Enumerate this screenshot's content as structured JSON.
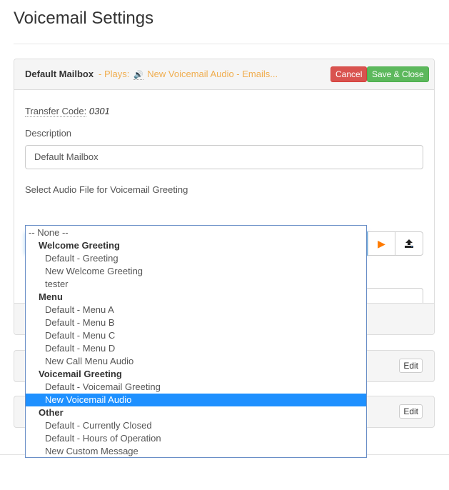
{
  "page": {
    "title": "Voicemail Settings"
  },
  "mailbox_panel": {
    "name": "Default Mailbox",
    "plays_prefix": "- Plays:",
    "speaker_icon": "🔊",
    "plays_text": "New Voicemail Audio - Emails...",
    "cancel_label": "Cancel",
    "save_label": "Save & Close",
    "transfer_code_label": "Transfer Code:",
    "transfer_code_value": "0301",
    "description_label": "Description",
    "description_value": "Default Mailbox",
    "audio_label": "Select Audio File for Voicemail Greeting",
    "audio_selected": "New Voicemail Audio",
    "caret_icon": "▼",
    "play_icon": "▶"
  },
  "colors": {
    "plays_text": "#f0ad4e",
    "cancel": "#d9534f",
    "save": "#5cb85c",
    "selected_option": "#1e90ff",
    "play_icon": "#ff7a00"
  },
  "collapsed_panels": [
    {
      "edit_label": "Edit"
    },
    {
      "edit_label": "Edit"
    }
  ],
  "dropdown": {
    "none_option": "-- None --",
    "groups": [
      {
        "label": "Welcome Greeting",
        "options": [
          "Default - Greeting",
          "New Welcome Greeting",
          "tester"
        ]
      },
      {
        "label": "Menu",
        "options": [
          "Default - Menu A",
          "Default - Menu B",
          "Default - Menu C",
          "Default - Menu D",
          "New Call Menu Audio"
        ]
      },
      {
        "label": "Voicemail Greeting",
        "options": [
          "Default - Voicemail Greeting",
          "New Voicemail Audio"
        ]
      },
      {
        "label": "Other",
        "options": [
          "Default - Currently Closed",
          "Default - Hours of Operation",
          "New Custom Message"
        ]
      }
    ],
    "selected": "New Voicemail Audio"
  }
}
